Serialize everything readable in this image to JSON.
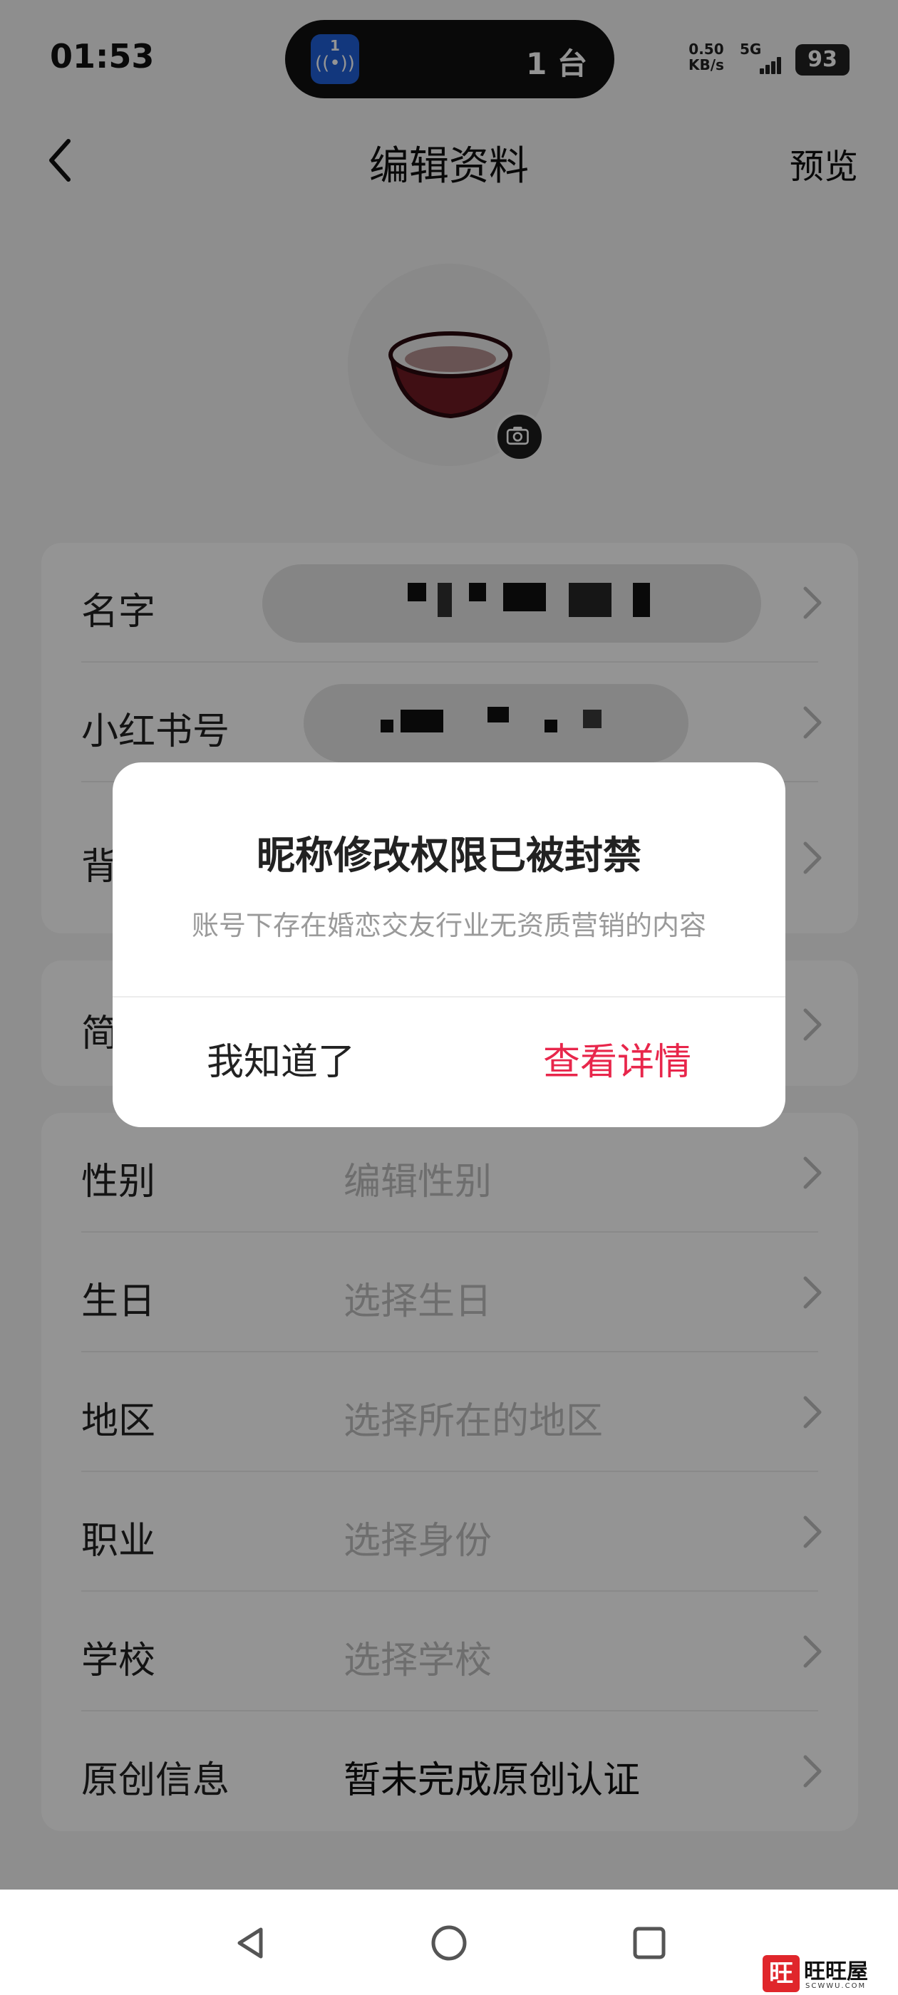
{
  "status_bar": {
    "time": "01:53",
    "island_badge": "1",
    "island_count": "1 台",
    "net_speed_value": "0.50",
    "net_speed_unit": "KB/s",
    "network_type": "5G",
    "battery": "93"
  },
  "header": {
    "title": "编辑资料",
    "preview_label": "预览"
  },
  "profile_card": {
    "rows": [
      {
        "label": "名字",
        "value": ""
      },
      {
        "label": "小红书号",
        "value": ""
      },
      {
        "label": "背",
        "value": ""
      }
    ]
  },
  "bio_card": {
    "rows": [
      {
        "label": "简",
        "value": ""
      }
    ]
  },
  "info_card": {
    "rows": [
      {
        "label": "性别",
        "value": "编辑性别"
      },
      {
        "label": "生日",
        "value": "选择生日"
      },
      {
        "label": "地区",
        "value": "选择所在的地区"
      },
      {
        "label": "职业",
        "value": "选择身份"
      },
      {
        "label": "学校",
        "value": "选择学校"
      },
      {
        "label": "原创信息",
        "value": "暂未完成原创认证"
      }
    ]
  },
  "dialog": {
    "title": "昵称修改权限已被封禁",
    "message": "账号下存在婚恋交友行业无资质营销的内容",
    "ok_label": "我知道了",
    "detail_label": "查看详情"
  },
  "watermark": {
    "badge": "旺",
    "text": "旺旺屋",
    "sub": "SCWWU.COM"
  },
  "colors": {
    "accent": "#e8264b",
    "overlay": "rgba(0,0,0,0.42)",
    "island_icon": "#1f5fd8"
  }
}
